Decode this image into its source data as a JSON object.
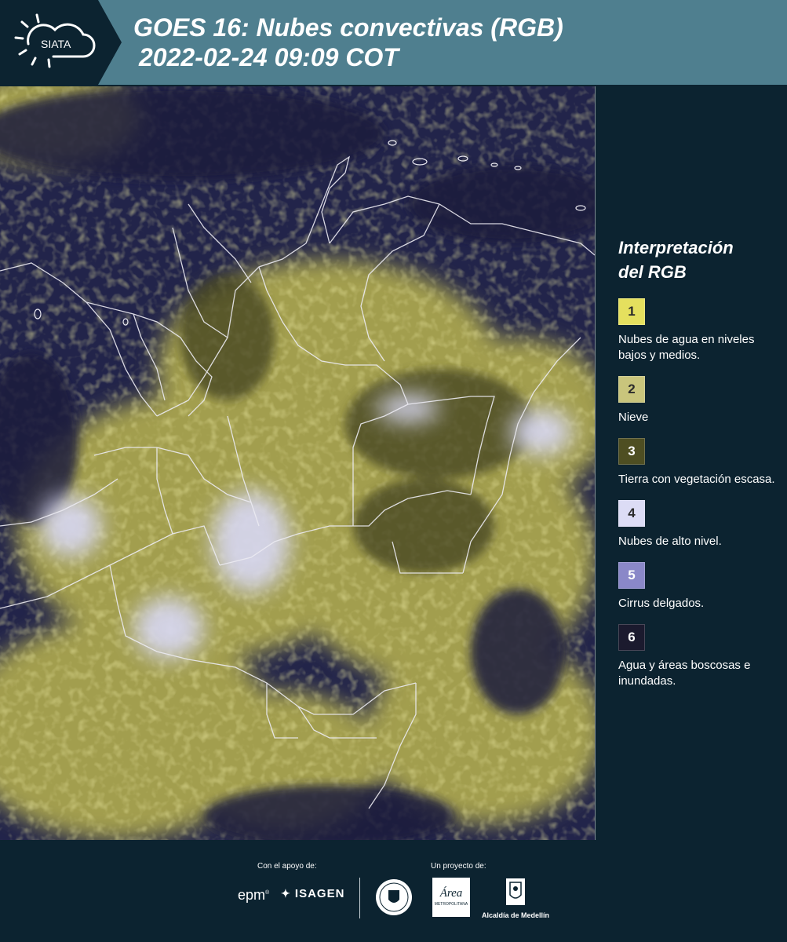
{
  "header": {
    "logo_text": "SIATA",
    "title_line1": "GOES 16: Nubes convectivas (RGB)",
    "title_line2": "2022-02-24 09:09 COT"
  },
  "map": {
    "description_icon": "satellite-rgb-map"
  },
  "legend": {
    "title_line1": "Interpretación",
    "title_line2": "del RGB",
    "items": [
      {
        "number": "1",
        "label": "Nubes de agua en niveles bajos y medios.",
        "color": "#e5e05e",
        "text_color": "#2b2b2b"
      },
      {
        "number": "2",
        "label": "Nieve",
        "color": "#c9c57c",
        "text_color": "#2b2b2b"
      },
      {
        "number": "3",
        "label": "Tierra con vegetación escasa.",
        "color": "#4e4e22",
        "text_color": "#ffffff"
      },
      {
        "number": "4",
        "label": "Nubes de alto nivel.",
        "color": "#dcdcf5",
        "text_color": "#2b2b2b"
      },
      {
        "number": "5",
        "label": "Cirrus delgados.",
        "color": "#8a88c8",
        "text_color": "#ffffff"
      },
      {
        "number": "6",
        "label": "Agua y áreas boscosas e inundadas.",
        "color": "#1b1a2e",
        "text_color": "#ffffff"
      }
    ]
  },
  "footer": {
    "support_label": "Con el apoyo de:",
    "project_label": "Un proyecto de:",
    "sponsors": {
      "epm": "epm",
      "isagen": "ISAGEN",
      "alcaldia": "Alcaldía de Medellín",
      "area_metro": "Área",
      "area_metro_sub": "METROPOLITANA"
    }
  },
  "colors": {
    "header_bg": "#4f7f8f",
    "logo_bg": "#0c2330",
    "page_bg": "#0c2330",
    "map_water": "#1f2140",
    "cloud_low": "#c9c35a",
    "cloud_high": "#d8d8f4",
    "border_line": "#e9e9ef"
  }
}
